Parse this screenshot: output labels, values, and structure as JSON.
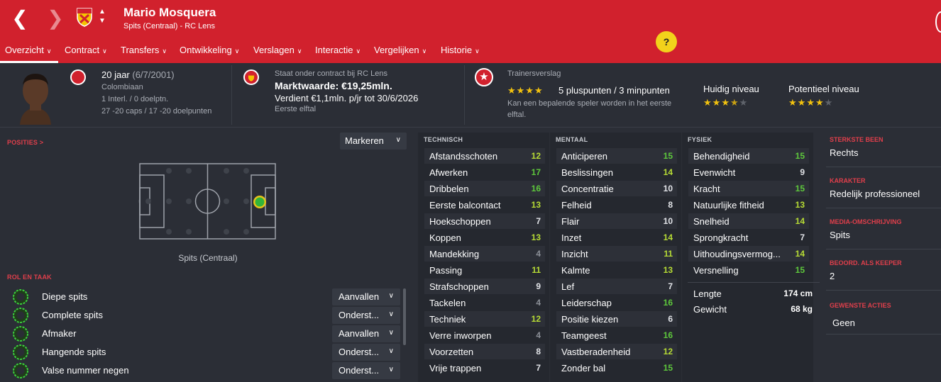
{
  "header": {
    "player_name": "Mario Mosquera",
    "subtitle": "Spits (Centraal) - RC Lens",
    "accent_color": "#d1212d"
  },
  "tabs": [
    {
      "label": "Overzicht"
    },
    {
      "label": "Contract"
    },
    {
      "label": "Transfers"
    },
    {
      "label": "Ontwikkeling"
    },
    {
      "label": "Verslagen"
    },
    {
      "label": "Interactie"
    },
    {
      "label": "Vergelijken"
    },
    {
      "label": "Historie"
    }
  ],
  "help_label": "?",
  "info": {
    "age": "20 jaar",
    "birthdate": "(6/7/2001)",
    "nationality": "Colombiaan",
    "intl": "1 Interl. / 0 doelptn.",
    "youth_caps": "27 -20 caps / 17 -20 doelpunten",
    "contract_label": "Staat onder contract bij RC Lens",
    "market_value": "Marktwaarde: €19,25mln.",
    "wage": "Verdient €1,1mln. p/jr tot 30/6/2026",
    "squad": "Eerste elftal",
    "report_title": "Trainersverslag",
    "report_stars": 4,
    "report_points": "5 pluspunten / 3 minpunten",
    "report_note_1": "Kan een bepalende speler worden in het eerste",
    "report_note_2": "elftal.",
    "current_label": "Huidig niveau",
    "current_stars": 3.5,
    "potential_label": "Potentieel niveau",
    "potential_stars": 4
  },
  "positions": {
    "title": "POSITIES >",
    "dropdown": "Markeren",
    "caption": "Spits (Centraal)"
  },
  "roles": {
    "title": "ROL EN TAAK",
    "items": [
      {
        "name": "Diepe spits",
        "duty": "Aanvallen"
      },
      {
        "name": "Complete spits",
        "duty": "Onderst..."
      },
      {
        "name": "Afmaker",
        "duty": "Aanvallen"
      },
      {
        "name": "Hangende spits",
        "duty": "Onderst..."
      },
      {
        "name": "Valse nummer negen",
        "duty": "Onderst..."
      }
    ]
  },
  "attributes": {
    "technical_title": "TECHNISCH",
    "mental_title": "MENTAAL",
    "physical_title": "FYSIEK",
    "technical": [
      {
        "name": "Afstandsschoten",
        "value": "12"
      },
      {
        "name": "Afwerken",
        "value": "17"
      },
      {
        "name": "Dribbelen",
        "value": "16"
      },
      {
        "name": "Eerste balcontact",
        "value": "13"
      },
      {
        "name": "Hoekschoppen",
        "value": "7"
      },
      {
        "name": "Koppen",
        "value": "13"
      },
      {
        "name": "Mandekking",
        "value": "4"
      },
      {
        "name": "Passing",
        "value": "11"
      },
      {
        "name": "Strafschoppen",
        "value": "9"
      },
      {
        "name": "Tackelen",
        "value": "4"
      },
      {
        "name": "Techniek",
        "value": "12"
      },
      {
        "name": "Verre inworpen",
        "value": "4"
      },
      {
        "name": "Voorzetten",
        "value": "8"
      },
      {
        "name": "Vrije trappen",
        "value": "7"
      }
    ],
    "mental": [
      {
        "name": "Anticiperen",
        "value": "15"
      },
      {
        "name": "Beslissingen",
        "value": "14"
      },
      {
        "name": "Concentratie",
        "value": "10"
      },
      {
        "name": "Felheid",
        "value": "8"
      },
      {
        "name": "Flair",
        "value": "10"
      },
      {
        "name": "Inzet",
        "value": "14"
      },
      {
        "name": "Inzicht",
        "value": "11"
      },
      {
        "name": "Kalmte",
        "value": "13"
      },
      {
        "name": "Lef",
        "value": "7"
      },
      {
        "name": "Leiderschap",
        "value": "16"
      },
      {
        "name": "Positie kiezen",
        "value": "6"
      },
      {
        "name": "Teamgeest",
        "value": "16"
      },
      {
        "name": "Vastberadenheid",
        "value": "12"
      },
      {
        "name": "Zonder bal",
        "value": "15"
      }
    ],
    "physical": [
      {
        "name": "Behendigheid",
        "value": "15"
      },
      {
        "name": "Evenwicht",
        "value": "9"
      },
      {
        "name": "Kracht",
        "value": "15"
      },
      {
        "name": "Natuurlijke fitheid",
        "value": "13"
      },
      {
        "name": "Snelheid",
        "value": "14"
      },
      {
        "name": "Sprongkracht",
        "value": "7"
      },
      {
        "name": "Uithoudingsvermog...",
        "value": "14"
      },
      {
        "name": "Versnelling",
        "value": "15"
      }
    ],
    "height_label": "Lengte",
    "height_value": "174 cm",
    "weight_label": "Gewicht",
    "weight_value": "68 kg"
  },
  "side": {
    "foot_title": "STERKSTE BEEN",
    "foot_value": "Rechts",
    "char_title": "KARAKTER",
    "char_value": "Redelijk professioneel",
    "media_title": "MEDIA-OMSCHRIJVING",
    "media_value": "Spits",
    "keeper_title": "BEOORD. ALS KEEPER",
    "keeper_value": "2",
    "actions_title": "GEWENSTE ACTIES",
    "actions_value": "Geen"
  }
}
